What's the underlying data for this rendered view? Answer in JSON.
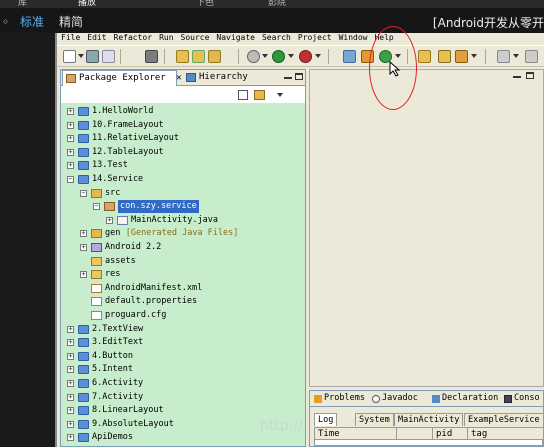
{
  "player": {
    "top_tabs": [
      "库",
      "播放",
      "下色",
      "影院"
    ],
    "controls": [
      {
        "label": "◦",
        "active": false
      },
      {
        "label": "标准",
        "active": true
      },
      {
        "label": "精简",
        "active": false
      }
    ],
    "video_title": "[Android开发从零开"
  },
  "menu": [
    "File",
    "Edit",
    "Refactor",
    "Run",
    "Source",
    "Navigate",
    "Search",
    "Project",
    "Window",
    "Help"
  ],
  "package_explorer": {
    "tab_label": "Package Explorer",
    "tab_close": "✕",
    "hierarchy_tab_label": "Hierarchy"
  },
  "tree": [
    {
      "label": "1.HelloWorld",
      "icon": "project-icon",
      "depth": 0,
      "expander": "+"
    },
    {
      "label": "10.FrameLayout",
      "icon": "project-icon",
      "depth": 0,
      "expander": "+"
    },
    {
      "label": "11.RelativeLayout",
      "icon": "project-icon",
      "depth": 0,
      "expander": "+"
    },
    {
      "label": "12.TableLayout",
      "icon": "project-icon",
      "depth": 0,
      "expander": "+"
    },
    {
      "label": "13.Test",
      "icon": "project-icon",
      "depth": 0,
      "expander": "+"
    },
    {
      "label": "14.Service",
      "icon": "project-icon",
      "depth": 0,
      "expander": "−"
    },
    {
      "label": "src",
      "icon": "source-folder-icon",
      "depth": 1,
      "expander": "−"
    },
    {
      "label": "con.szy.service",
      "icon": "package-icon",
      "depth": 2,
      "expander": "−",
      "selected": true
    },
    {
      "label": "MainActivity.java",
      "icon": "java-file-icon",
      "depth": 3,
      "expander": "+"
    },
    {
      "label": "gen",
      "icon": "source-folder-icon",
      "depth": 1,
      "expander": "+",
      "decoration": "[Generated Java Files]"
    },
    {
      "label": "Android 2.2",
      "icon": "library-icon",
      "depth": 1,
      "expander": "+"
    },
    {
      "label": "assets",
      "icon": "folder-icon",
      "depth": 1,
      "expander": ""
    },
    {
      "label": "res",
      "icon": "folder-icon",
      "depth": 1,
      "expander": "+"
    },
    {
      "label": "AndroidManifest.xml",
      "icon": "xml-file-icon",
      "depth": 1,
      "expander": ""
    },
    {
      "label": "default.properties",
      "icon": "file-icon",
      "depth": 1,
      "expander": ""
    },
    {
      "label": "proguard.cfg",
      "icon": "file-icon",
      "depth": 1,
      "expander": ""
    },
    {
      "label": "2.TextView",
      "icon": "project-icon",
      "depth": 0,
      "expander": "+"
    },
    {
      "label": "3.EditText",
      "icon": "project-icon",
      "depth": 0,
      "expander": "+"
    },
    {
      "label": "4.Button",
      "icon": "project-icon",
      "depth": 0,
      "expander": "+"
    },
    {
      "label": "5.Intent",
      "icon": "project-icon",
      "depth": 0,
      "expander": "+"
    },
    {
      "label": "6.Activity",
      "icon": "project-icon",
      "depth": 0,
      "expander": "+"
    },
    {
      "label": "7.Activity",
      "icon": "project-icon",
      "depth": 0,
      "expander": "+"
    },
    {
      "label": "8.LinearLayout",
      "icon": "project-icon",
      "depth": 0,
      "expander": "+"
    },
    {
      "label": "9.AbsoluteLayout",
      "icon": "project-icon",
      "depth": 0,
      "expander": "+"
    },
    {
      "label": "ApiDemos",
      "icon": "project-icon",
      "depth": 0,
      "expander": "+"
    }
  ],
  "bottom_panel": {
    "tabs": [
      "Problems",
      "Javadoc",
      "Declaration",
      "Conso"
    ],
    "logcat_tabs": [
      "Log",
      "System",
      "MainActivity",
      "ExampleService"
    ],
    "columns": [
      "Time",
      "",
      "pid",
      "tag"
    ]
  },
  "watermark": "http://"
}
